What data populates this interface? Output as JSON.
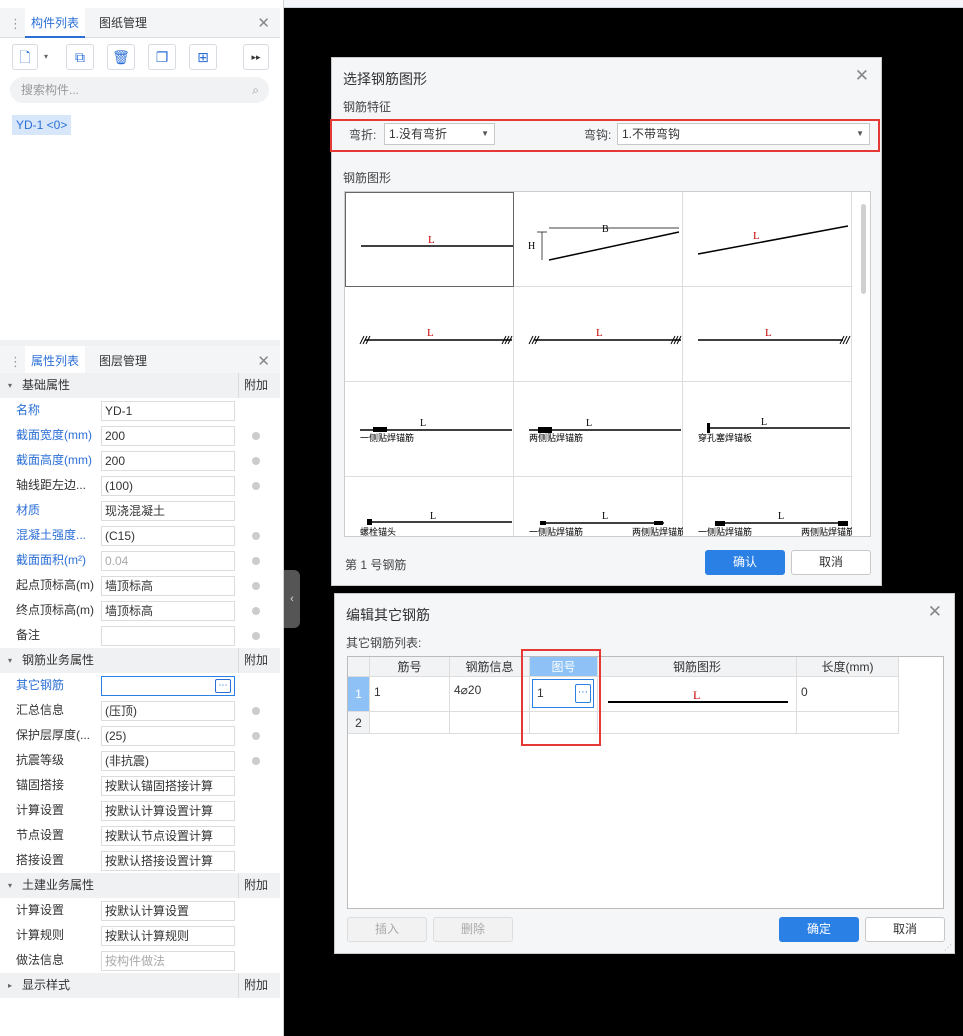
{
  "left_top_panel": {
    "tabs": [
      "构件列表",
      "图纸管理"
    ],
    "search_placeholder": "搜索构件...",
    "component_item": "YD-1 <0>"
  },
  "prop_panel": {
    "tabs": [
      "属性列表",
      "图层管理"
    ],
    "add_label": "附加",
    "sections": {
      "basic": "基础属性",
      "rebar": "钢筋业务属性",
      "civil": "土建业务属性",
      "display": "显示样式"
    },
    "rows": [
      {
        "label": "名称",
        "value": "YD-1"
      },
      {
        "label": "截面宽度(mm)",
        "value": "200"
      },
      {
        "label": "截面高度(mm)",
        "value": "200"
      },
      {
        "label": "轴线距左边...",
        "value": "(100)"
      },
      {
        "label": "材质",
        "value": "现浇混凝土"
      },
      {
        "label": "混凝土强度...",
        "value": "(C15)"
      },
      {
        "label": "截面面积(m²)",
        "value": "0.04"
      },
      {
        "label": "起点顶标高(m)",
        "value": "墙顶标高"
      },
      {
        "label": "终点顶标高(m)",
        "value": "墙顶标高"
      },
      {
        "label": "备注",
        "value": ""
      },
      {
        "label": "其它钢筋",
        "value": ""
      },
      {
        "label": "汇总信息",
        "value": "(压顶)"
      },
      {
        "label": "保护层厚度(...",
        "value": "(25)"
      },
      {
        "label": "抗震等级",
        "value": "(非抗震)"
      },
      {
        "label": "锚固搭接",
        "value": "按默认锚固搭接计算"
      },
      {
        "label": "计算设置",
        "value": "按默认计算设置计算"
      },
      {
        "label": "节点设置",
        "value": "按默认节点设置计算"
      },
      {
        "label": "搭接设置",
        "value": "按默认搭接设置计算"
      },
      {
        "label": "计算设置",
        "value": "按默认计算设置"
      },
      {
        "label": "计算规则",
        "value": "按默认计算规则"
      },
      {
        "label": "做法信息",
        "value": "按构件做法"
      }
    ]
  },
  "dialog_shape": {
    "title": "选择钢筋图形",
    "feature_label": "钢筋特征",
    "bend_label": "弯折:",
    "bend_value": "1.没有弯折",
    "hook_label": "弯钩:",
    "hook_value": "1.不带弯钩",
    "shape_label": "钢筋图形",
    "shape_labels": {
      "L": "L",
      "B": "B",
      "H": "H"
    },
    "captions": [
      "一侧贴焊锚筋",
      "两侧贴焊锚筋",
      "穿孔塞焊锚板",
      "螺栓锚头",
      "一侧贴焊锚筋",
      "一侧贴焊锚筋",
      "两侧贴焊锚筋",
      "两侧贴焊锚筋"
    ],
    "footer": "第 1 号钢筋",
    "ok": "确认",
    "cancel": "取消"
  },
  "dialog_other": {
    "title": "编辑其它钢筋",
    "list_label": "其它钢筋列表:",
    "headers": [
      "筋号",
      "钢筋信息",
      "图号",
      "钢筋图形",
      "长度(mm)"
    ],
    "rows": [
      {
        "num": "1",
        "bar_no": "1",
        "info": "4⌀20",
        "shape_no": "1",
        "shape_label": "L",
        "length": "0"
      },
      {
        "num": "2",
        "bar_no": "",
        "info": "",
        "shape_no": "",
        "shape_label": "",
        "length": ""
      }
    ],
    "insert": "插入",
    "delete": "删除",
    "ok": "确定",
    "cancel": "取消"
  },
  "colors": {
    "accent": "#2b80e6",
    "highlight": "#e53935",
    "selected_header": "#8ec1f5"
  },
  "icons": [
    "new-icon",
    "copy-icon",
    "delete-icon",
    "duplicate-icon",
    "layer-icon",
    "more-icon",
    "search-icon",
    "close-icon",
    "collapse-icon",
    "ellipsis-icon"
  ]
}
